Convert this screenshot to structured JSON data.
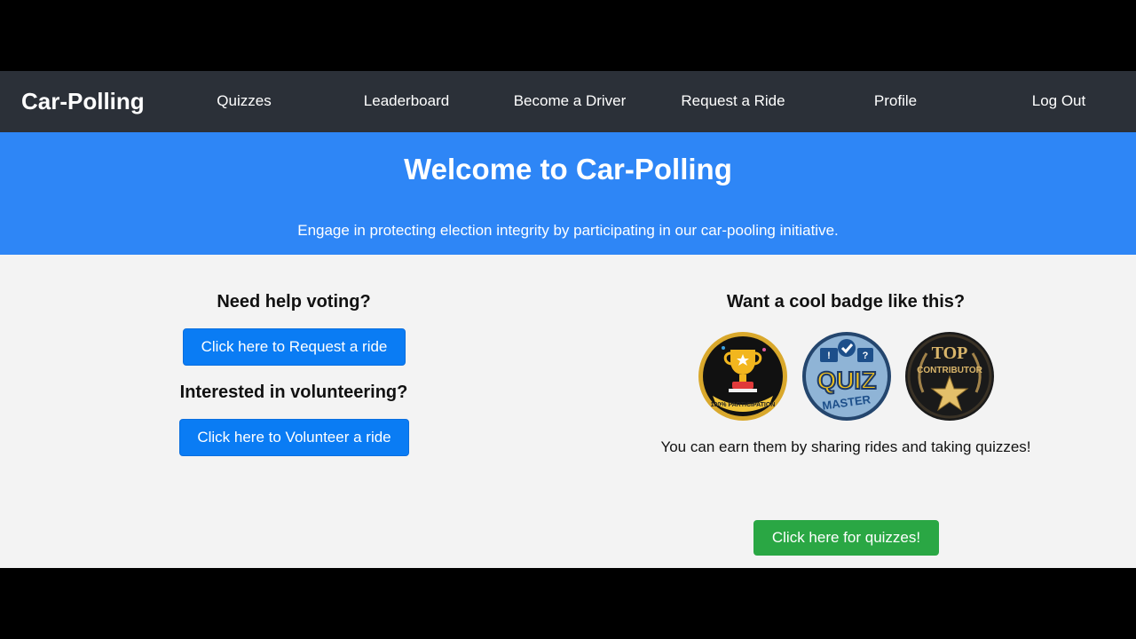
{
  "nav": {
    "brand": "Car-Polling",
    "links": [
      "Quizzes",
      "Leaderboard",
      "Become a Driver",
      "Request a Ride",
      "Profile",
      "Log Out"
    ]
  },
  "hero": {
    "title": "Welcome to Car-Polling",
    "subtitle": "Engage in protecting election integrity by participating in our car-pooling initiative."
  },
  "left": {
    "voting_heading": "Need help voting?",
    "request_button": "Click here to Request a ride",
    "volunteer_heading": "Interested in volunteering?",
    "volunteer_button": "Click here to Volunteer a ride"
  },
  "right": {
    "badge_heading": "Want a cool badge like this?",
    "badges": [
      {
        "icon": "trophy-badge-icon",
        "text": "100% PARTICIPATION"
      },
      {
        "icon": "quiz-master-badge-icon",
        "text_top": "QUIZ",
        "text_bottom": "MASTER"
      },
      {
        "icon": "top-contributor-badge-icon",
        "text_top": "TOP",
        "text_bottom": "CONTRIBUTOR"
      }
    ],
    "earn_note": "You can earn them by sharing rides and taking quizzes!",
    "quiz_button": "Click here for quizzes!"
  },
  "colors": {
    "navbar": "#2b3038",
    "hero": "#2e86f6",
    "primary_button": "#0a7cf4",
    "success_button": "#2aa744",
    "page_bg": "#f3f3f3"
  }
}
